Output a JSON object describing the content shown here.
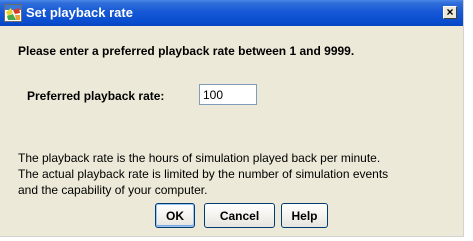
{
  "window": {
    "title": "Set playback rate",
    "close_glyph": "×"
  },
  "prompt": {
    "heading": "Please enter a preferred playback rate between 1 and 9999.",
    "label": "Preferred playback rate:",
    "value": "100"
  },
  "description": {
    "lines": [
      "The playback rate is the hours of simulation played back per minute.",
      "The actual playback rate is limited by the number of simulation events",
      "and the capability of your computer."
    ]
  },
  "buttons": {
    "ok": "OK",
    "cancel": "Cancel",
    "help": "Help"
  },
  "colors": {
    "titlebar": "#0a4fd0",
    "dialog_bg": "#ece9d8",
    "button_border": "#003c74"
  },
  "icons": {
    "title": "application-icon",
    "close": "close-icon"
  }
}
